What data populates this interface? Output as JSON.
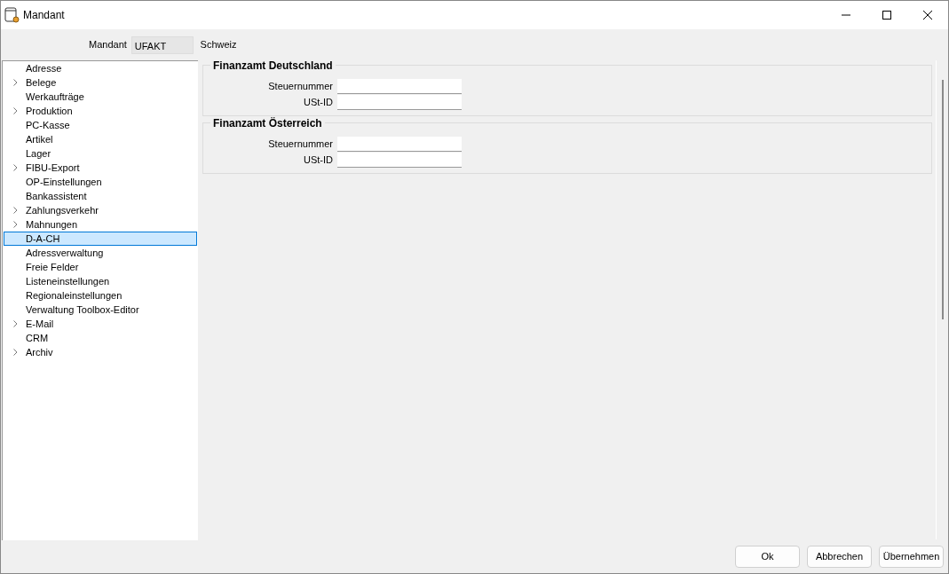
{
  "window": {
    "title": "Mandant"
  },
  "header": {
    "label": "Mandant",
    "value": "UFAKT",
    "description": "Schweiz"
  },
  "tree": [
    {
      "label": "Adresse",
      "expandable": false,
      "selected": false
    },
    {
      "label": "Belege",
      "expandable": true,
      "selected": false
    },
    {
      "label": "Werkaufträge",
      "expandable": false,
      "selected": false
    },
    {
      "label": "Produktion",
      "expandable": true,
      "selected": false
    },
    {
      "label": "PC-Kasse",
      "expandable": false,
      "selected": false
    },
    {
      "label": "Artikel",
      "expandable": false,
      "selected": false
    },
    {
      "label": "Lager",
      "expandable": false,
      "selected": false
    },
    {
      "label": "FIBU-Export",
      "expandable": true,
      "selected": false
    },
    {
      "label": "OP-Einstellungen",
      "expandable": false,
      "selected": false
    },
    {
      "label": "Bankassistent",
      "expandable": false,
      "selected": false
    },
    {
      "label": "Zahlungsverkehr",
      "expandable": true,
      "selected": false
    },
    {
      "label": "Mahnungen",
      "expandable": true,
      "selected": false
    },
    {
      "label": "D-A-CH",
      "expandable": false,
      "selected": true
    },
    {
      "label": "Adressverwaltung",
      "expandable": false,
      "selected": false
    },
    {
      "label": "Freie Felder",
      "expandable": false,
      "selected": false
    },
    {
      "label": "Listeneinstellungen",
      "expandable": false,
      "selected": false
    },
    {
      "label": "Regionaleinstellungen",
      "expandable": false,
      "selected": false
    },
    {
      "label": "Verwaltung Toolbox-Editor",
      "expandable": false,
      "selected": false
    },
    {
      "label": "E-Mail",
      "expandable": true,
      "selected": false
    },
    {
      "label": "CRM",
      "expandable": false,
      "selected": false
    },
    {
      "label": "Archiv",
      "expandable": true,
      "selected": false
    }
  ],
  "groups": [
    {
      "title": "Finanzamt Deutschland",
      "fields": [
        {
          "label": "Steuernummer"
        },
        {
          "label": "USt-ID"
        }
      ]
    },
    {
      "title": "Finanzamt Österreich",
      "fields": [
        {
          "label": "Steuernummer"
        },
        {
          "label": "USt-ID"
        }
      ]
    }
  ],
  "buttons": [
    "Ok",
    "Abbrechen",
    "Übernehmen"
  ]
}
